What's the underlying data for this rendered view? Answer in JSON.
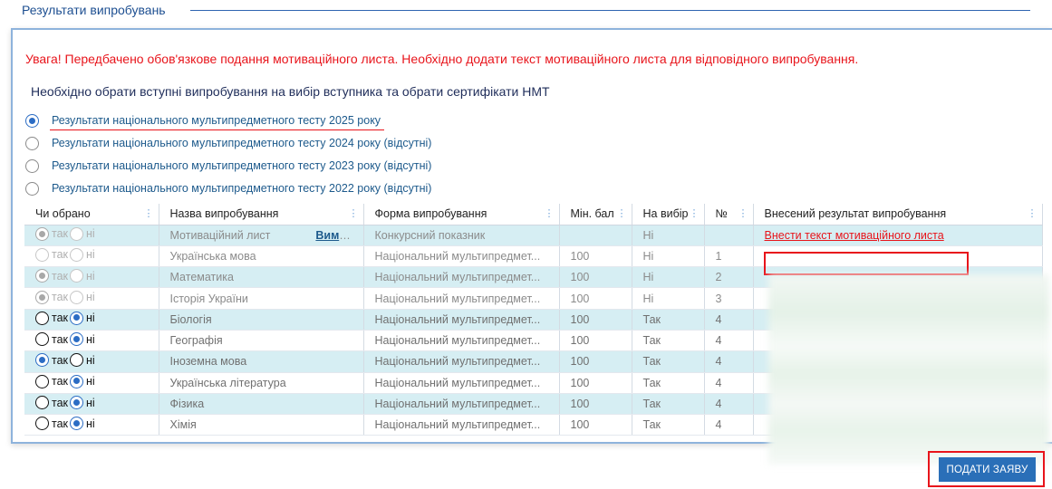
{
  "section": {
    "title": "Результати випробувань"
  },
  "warning": "Увага! Передбачено обов'язкове подання мотиваційного листа. Необхідно додати текст мотиваційного листа для відповідного випробування.",
  "subtitle": "Необхідно обрати вступні випробування на вибір вступника та обрати сертифікати НМТ",
  "nmt_options": [
    {
      "label": "Результати національного мультипредметного тесту 2025 року",
      "selected": true
    },
    {
      "label": "Результати національного мультипредметного тесту 2024 року (відсутні)",
      "selected": false
    },
    {
      "label": "Результати національного мультипредметного тесту 2023 року (відсутні)",
      "selected": false
    },
    {
      "label": "Результати національного мультипредметного тесту 2022 року (відсутні)",
      "selected": false
    }
  ],
  "table": {
    "columns": [
      "Чи обрано",
      "Назва випробування",
      "Форма випробування",
      "Мін. бал",
      "На вибір",
      "№",
      "Внесений результат випробування"
    ],
    "yes_label": "так",
    "no_label": "ні",
    "requirements_link": "Вимоги",
    "motivation_link": "Внести текст мотиваційного листа",
    "rows": [
      {
        "chosen": "yes",
        "editable": false,
        "name": "Мотиваційний лист",
        "form": "Конкурсний показник",
        "min": "",
        "optional": "Ні",
        "num": ""
      },
      {
        "chosen": "none",
        "editable": false,
        "name": "Українська мова",
        "form": "Національний мультипредмет...",
        "min": "100",
        "optional": "Ні",
        "num": "1"
      },
      {
        "chosen": "yes",
        "editable": false,
        "name": "Математика",
        "form": "Національний мультипредмет...",
        "min": "100",
        "optional": "Ні",
        "num": "2"
      },
      {
        "chosen": "yes",
        "editable": false,
        "name": "Історія України",
        "form": "Національний мультипредмет...",
        "min": "100",
        "optional": "Ні",
        "num": "3"
      },
      {
        "chosen": "no",
        "editable": true,
        "name": "Біологія",
        "form": "Національний мультипредмет...",
        "min": "100",
        "optional": "Так",
        "num": "4"
      },
      {
        "chosen": "no",
        "editable": true,
        "name": "Географія",
        "form": "Національний мультипредмет...",
        "min": "100",
        "optional": "Так",
        "num": "4"
      },
      {
        "chosen": "yes",
        "editable": true,
        "name": "Іноземна мова",
        "form": "Національний мультипредмет...",
        "min": "100",
        "optional": "Так",
        "num": "4"
      },
      {
        "chosen": "no",
        "editable": true,
        "name": "Українська література",
        "form": "Національний мультипредмет...",
        "min": "100",
        "optional": "Так",
        "num": "4"
      },
      {
        "chosen": "no",
        "editable": true,
        "name": "Фізика",
        "form": "Національний мультипредмет...",
        "min": "100",
        "optional": "Так",
        "num": "4"
      },
      {
        "chosen": "no",
        "editable": true,
        "name": "Хімія",
        "form": "Національний мультипредмет...",
        "min": "100",
        "optional": "Так",
        "num": "4"
      }
    ]
  },
  "submit_label": "ПОДАТИ ЗАЯВУ",
  "colors": {
    "warning": "#e8141b",
    "accent": "#2a6fb8",
    "row_alt": "#d6eef3"
  }
}
